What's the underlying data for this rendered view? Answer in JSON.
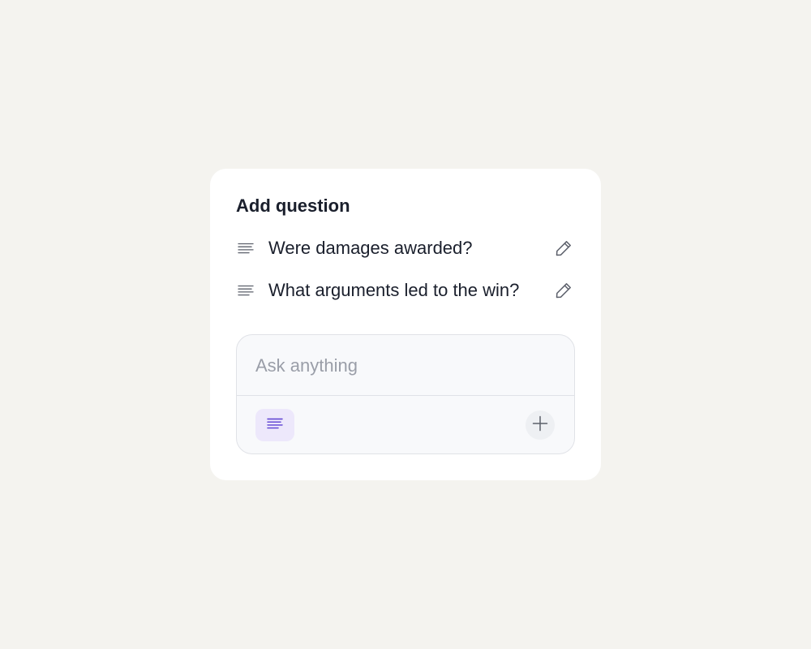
{
  "card": {
    "title": "Add question",
    "questions": [
      {
        "text": "Were damages awarded?",
        "type_icon": "text-lines-icon",
        "action_icon": "pencil-icon"
      },
      {
        "text": "What arguments led to the win?",
        "type_icon": "text-lines-icon",
        "action_icon": "pencil-icon"
      }
    ]
  },
  "composer": {
    "placeholder": "Ask anything",
    "value": "",
    "format_icon": "text-lines-icon",
    "add_icon": "plus-icon"
  },
  "colors": {
    "background": "#f4f3ef",
    "card": "#ffffff",
    "text": "#1a1f2c",
    "placeholder": "#9a9ea8",
    "accent": "#5b3fd1",
    "accent_bg": "#ede8fb"
  }
}
